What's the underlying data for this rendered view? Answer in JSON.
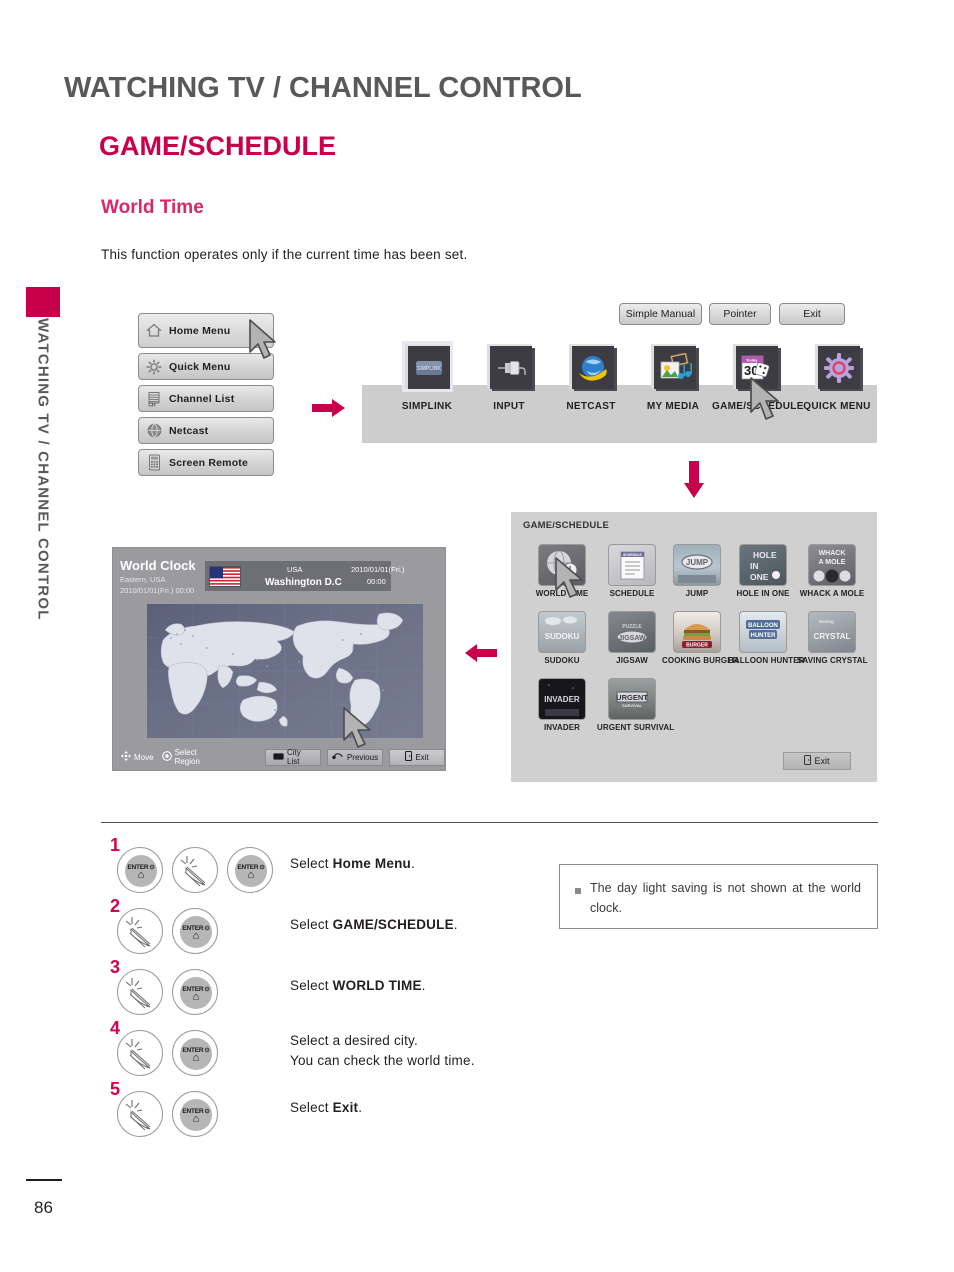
{
  "sidebar": {
    "vertical_label": "WATCHING TV / CHANNEL CONTROL"
  },
  "header": {
    "page_title": "WATCHING TV / CHANNEL CONTROL",
    "section_title": "GAME/SCHEDULE",
    "sub_title": "World Time",
    "intro": "This function operates only if the current time has been set."
  },
  "menu": {
    "items": [
      {
        "label": "Home Menu",
        "icon": "home-icon"
      },
      {
        "label": "Quick Menu",
        "icon": "gear-icon"
      },
      {
        "label": "Channel List",
        "icon": "channel-list-icon"
      },
      {
        "label": "Netcast",
        "icon": "globe-icon"
      },
      {
        "label": "Screen Remote",
        "icon": "remote-icon"
      }
    ]
  },
  "home_panel": {
    "buttons": [
      {
        "label": "Simple Manual"
      },
      {
        "label": "Pointer"
      },
      {
        "label": "Exit"
      }
    ],
    "icons": [
      {
        "label": "SIMPLINK",
        "icon": "simplink-icon"
      },
      {
        "label": "INPUT",
        "icon": "input-plug-icon"
      },
      {
        "label": "NETCAST",
        "icon": "netcast-globe-icon"
      },
      {
        "label": "MY MEDIA",
        "icon": "my-media-icon"
      },
      {
        "label": "GAME/SCHEDULE",
        "icon": "calendar-dice-icon"
      },
      {
        "label": "QUICK MENU",
        "icon": "quick-menu-gear-icon"
      }
    ],
    "calendar_icon": {
      "today_label": "Today",
      "day_number": "30"
    }
  },
  "game_schedule": {
    "caption": "GAME/SCHEDULE",
    "exit_label": "Exit",
    "tiles": [
      {
        "label": "WORLD TIME",
        "art": "WORLD TIME",
        "bg": "#6d6d72"
      },
      {
        "label": "SCHEDULE",
        "art": "SCHEDULE",
        "bg": "#c9c9cc"
      },
      {
        "label": "JUMP",
        "art": "JUMP",
        "bg": "#8e9ba5"
      },
      {
        "label": "HOLE IN ONE",
        "art": "HOLE IN ONE",
        "bg": "#5f6b73"
      },
      {
        "label": "WHACK A MOLE",
        "art": "WHACK A MOLE",
        "bg": "#7d7d82"
      },
      {
        "label": "SUDOKU",
        "art": "SUDOKU",
        "bg": "#a9b0b5"
      },
      {
        "label": "JIGSAW",
        "art": "JIGSAW",
        "bg": "#70757a"
      },
      {
        "label": "COOKING BURGER",
        "art": "COOKING BURGER",
        "bg": "#b9b3ae"
      },
      {
        "label": "BALLOON HUNTER",
        "art": "BALLOON HUNTER",
        "bg": "#cfd4d8"
      },
      {
        "label": "SAVING CRYSTAL",
        "art": "SAVING CRYSTAL",
        "bg": "#9aa0a6"
      },
      {
        "label": "INVADER",
        "art": "INVADER",
        "bg": "#1e1e22"
      },
      {
        "label": "URGENT SURVIVAL",
        "art": "URGENT SURVIVAL",
        "bg": "#7c7f82"
      }
    ]
  },
  "world_clock": {
    "title": "World Clock",
    "region_line": "Eastern, USA",
    "local_time_line": "2010/01/01(Fri.) 00:00",
    "selected_city": {
      "country": "USA",
      "city": "Washington D.C",
      "date": "2010/01/01(Fri.)",
      "time": "00:00"
    },
    "hints": [
      {
        "label": "Move",
        "icon": "dpad-icon"
      },
      {
        "label": "Select Region",
        "icon": "wheel-icon"
      }
    ],
    "buttons": [
      {
        "label": "City List",
        "icon": "list-key-icon"
      },
      {
        "label": "Previous",
        "icon": "back-icon"
      },
      {
        "label": "Exit",
        "icon": "exit-icon"
      }
    ]
  },
  "steps": [
    {
      "num": "1",
      "knobs": [
        "enter",
        "pointer",
        "enter"
      ],
      "text_prefix": "Select ",
      "text_bold": "Home Menu",
      "text_suffix": ".",
      "line2": ""
    },
    {
      "num": "2",
      "knobs": [
        "pointer",
        "enter"
      ],
      "text_prefix": "Select ",
      "text_bold": "GAME/SCHEDULE",
      "text_suffix": ".",
      "line2": ""
    },
    {
      "num": "3",
      "knobs": [
        "pointer",
        "enter"
      ],
      "text_prefix": "Select ",
      "text_bold": "WORLD TIME",
      "text_suffix": ".",
      "line2": ""
    },
    {
      "num": "4",
      "knobs": [
        "pointer",
        "enter"
      ],
      "text_prefix": "Select a desired city.",
      "text_bold": "",
      "text_suffix": "",
      "line2": "You can check the world time."
    },
    {
      "num": "5",
      "knobs": [
        "pointer",
        "enter"
      ],
      "text_prefix": "Select ",
      "text_bold": "Exit",
      "text_suffix": ".",
      "line2": ""
    }
  ],
  "knob_labels": {
    "enter": "ENTER",
    "enter_symbol": "⊙",
    "home_symbol": "⌂"
  },
  "note": {
    "text": "The day light saving is not shown at the world clock."
  },
  "footer": {
    "page_number": "86"
  },
  "colors": {
    "accent": "#c8004b",
    "accent_light": "#d6286a",
    "title_gray": "#58595b",
    "panel_gray": "#cdcdcd"
  }
}
